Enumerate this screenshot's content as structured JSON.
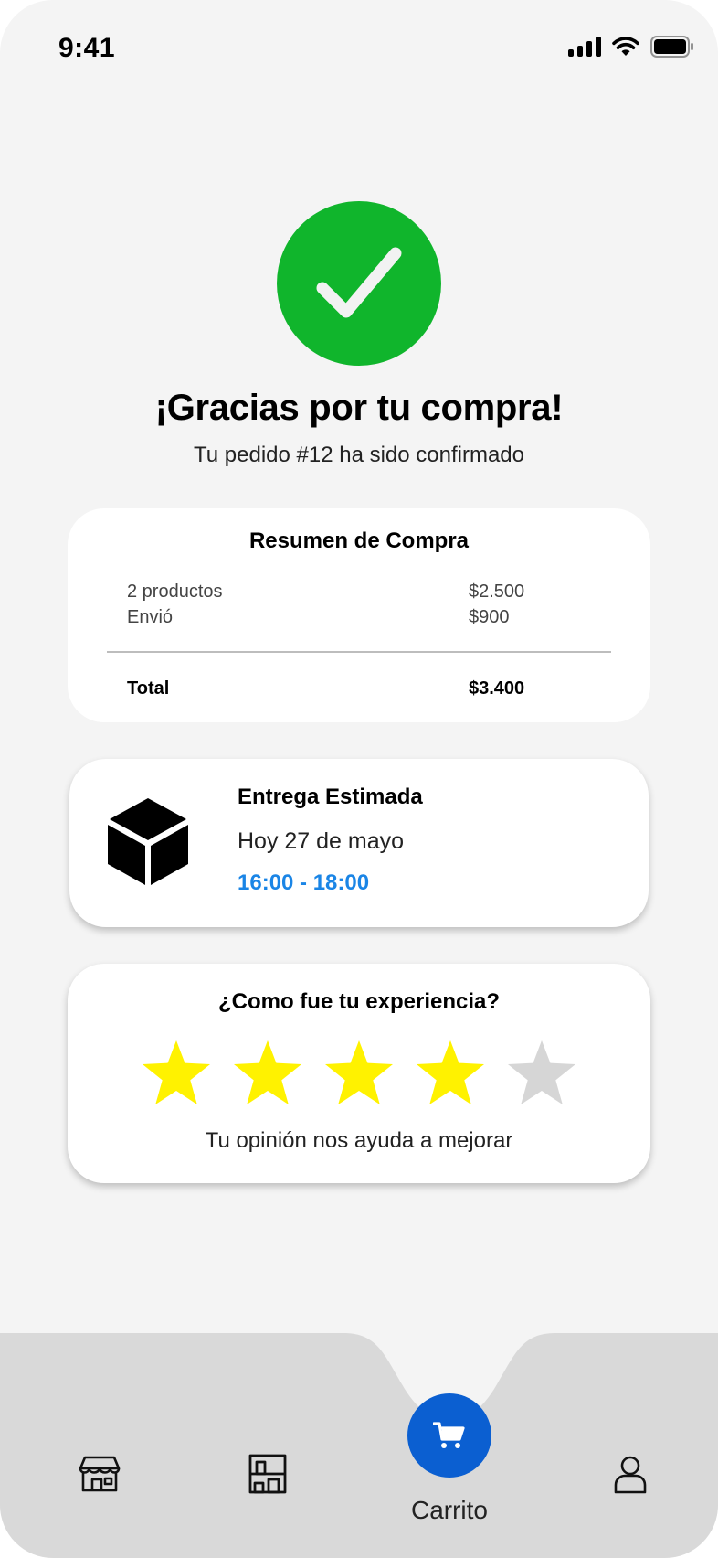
{
  "status_bar": {
    "time": "9:41"
  },
  "confirmation": {
    "title": "¡Gracias por tu compra!",
    "subtitle": "Tu pedido #12 ha sido confirmado"
  },
  "summary": {
    "title": "Resumen de Compra",
    "rows": [
      {
        "label": "2 productos",
        "value": "$2.500"
      },
      {
        "label": "Envió",
        "value": "$900"
      }
    ],
    "total_label": "Total",
    "total_value": "$3.400"
  },
  "delivery": {
    "title": "Entrega Estimada",
    "date": "Hoy 27 de mayo",
    "time_window": "16:00 - 18:00"
  },
  "rating": {
    "title": "¿Como fue tu experiencia?",
    "value": 4,
    "max": 5,
    "subtitle": "Tu opinión nos ayuda a mejorar"
  },
  "bottom_nav": {
    "items": [
      {
        "icon": "store-icon"
      },
      {
        "icon": "shelves-icon"
      },
      {
        "icon": "cart-icon",
        "label": "Carrito",
        "active": true
      },
      {
        "icon": "user-icon"
      }
    ]
  },
  "colors": {
    "success": "#10b52c",
    "accent_blue": "#1a85e6",
    "cart_button": "#0b5fd1",
    "star_filled": "#fff200",
    "star_empty": "#d6d6d6"
  }
}
